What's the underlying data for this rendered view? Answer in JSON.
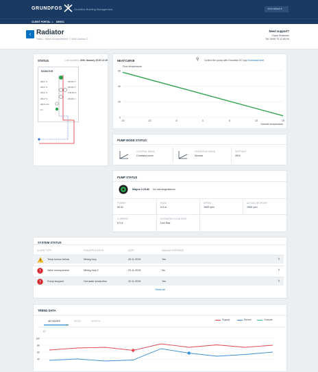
{
  "topbar": {
    "brand": "GRUNDFOS",
    "app_name": "Grundfos Building Management",
    "user_menu": "View default ▾"
  },
  "breadcrumb": [
    "CLIENT PORTAL",
    "DEKK1"
  ],
  "header": {
    "back_icon": "chevron-left-icon",
    "title": "Radiator",
    "subtitle": "Dekk1, Hørsk Kiimperresen® 2, 8000 Aarhus C"
  },
  "support": {
    "heading": "Need support?",
    "name": "Claus Pedersen",
    "tel": "Tel: 0045 70 12 85 00"
  },
  "status": {
    "title": "STATUS",
    "updated_label": "Last updated:",
    "updated_value": "24th January 2019 12:10",
    "diagram_title": "RADIATOR",
    "left_values": [
      "200,2 °C",
      "200,2 °C",
      "200,2 °C",
      "200,2 °C",
      "200,6 m³/h",
      "0 h"
    ],
    "right_values": [
      "250,00 m³",
      "250,00 m³",
      "2 20,00 m³",
      "200,00 m³"
    ]
  },
  "heatcurve": {
    "title": "HEATCURVE",
    "control_text": "Control the pump with Grundfos GO app",
    "download_label": "Download here"
  },
  "chart_data": {
    "type": "line",
    "title": "",
    "ylabel": "Flow temperature",
    "xlabel": "Outside temperature",
    "x_ticks": [
      -15,
      -10,
      -5,
      0,
      5,
      10,
      15
    ],
    "y_ticks": [
      0,
      20,
      40,
      60
    ],
    "xlim": [
      -15,
      15
    ],
    "ylim": [
      0,
      60
    ],
    "series": [
      {
        "x": [
          -15,
          15
        ],
        "y": [
          58,
          2
        ],
        "color": "#2ea24f"
      }
    ],
    "grid": true
  },
  "pump_mode": {
    "title": "PUMP MODE STATUS",
    "control_mode_label": "CONTROL MODE",
    "control_mode_value": "Constant curve",
    "operating_mode_label": "OPERATING MODE",
    "operating_mode_value": "Normal",
    "setpoint_label": "SETPOINT",
    "setpoint_value": "28%"
  },
  "pump_status": {
    "title": "PUMP STATUS",
    "pump_name": "Magna 3 25-80",
    "pump_message": "No warnings/alarms",
    "metrics": [
      {
        "label": "POWER",
        "value": "50 W"
      },
      {
        "label": "HEAD",
        "value": "0.0 m"
      },
      {
        "label": "SPEED",
        "value": "1900 rpm"
      },
      {
        "label": "ACTUAL SETPOINT",
        "value": "1900 rpm"
      },
      {
        "label": "CURRENT",
        "value": "0.0 A"
      },
      {
        "label": "ESTIMATED FLOW RATE",
        "value": "Low flow"
      }
    ]
  },
  "system_status": {
    "title": "SYSTEM STATUS",
    "columns": [
      "ALARM TYPE",
      "SUB APPLICATION",
      "DATE",
      "MANUAL OVERRIDE"
    ],
    "rows": [
      {
        "icon": "warning-icon",
        "icon_color": "#f2b81e",
        "alarm": "Temp sensor failure",
        "sub": "Mixing loop",
        "date": "28.11.2019",
        "override": "Yes"
      },
      {
        "icon": "alert-icon",
        "icon_color": "#d8262e",
        "alarm": "Valve unresponsive",
        "sub": "Mixing loop 2",
        "date": "23.11.2019",
        "override": "No"
      },
      {
        "icon": "alert-icon",
        "icon_color": "#d8262e",
        "alarm": "Pump stopped",
        "sub": "Hot water production",
        "date": "22.11.2019",
        "override": "Yes"
      }
    ],
    "show_all": "Show all"
  },
  "trend": {
    "title": "TREND DATA",
    "tabs": [
      "48 HOURS",
      "WEEK",
      "MONTH"
    ],
    "active_tab": 0,
    "legend": [
      {
        "name": "Supply",
        "color": "#e0454b"
      },
      {
        "name": "Return",
        "color": "#3a8fd6"
      },
      {
        "name": "Outside",
        "color": "#2fb892"
      }
    ],
    "unit": "C°",
    "y_ticks": [
      "100",
      "80",
      "60",
      "40"
    ],
    "supply": [
      66,
      72,
      74,
      65,
      84,
      74,
      81,
      74,
      80
    ],
    "return": [
      36,
      40,
      34,
      37,
      70,
      57,
      48,
      53,
      60
    ],
    "supply_marker_index": 3,
    "return_marker_index": 5
  }
}
